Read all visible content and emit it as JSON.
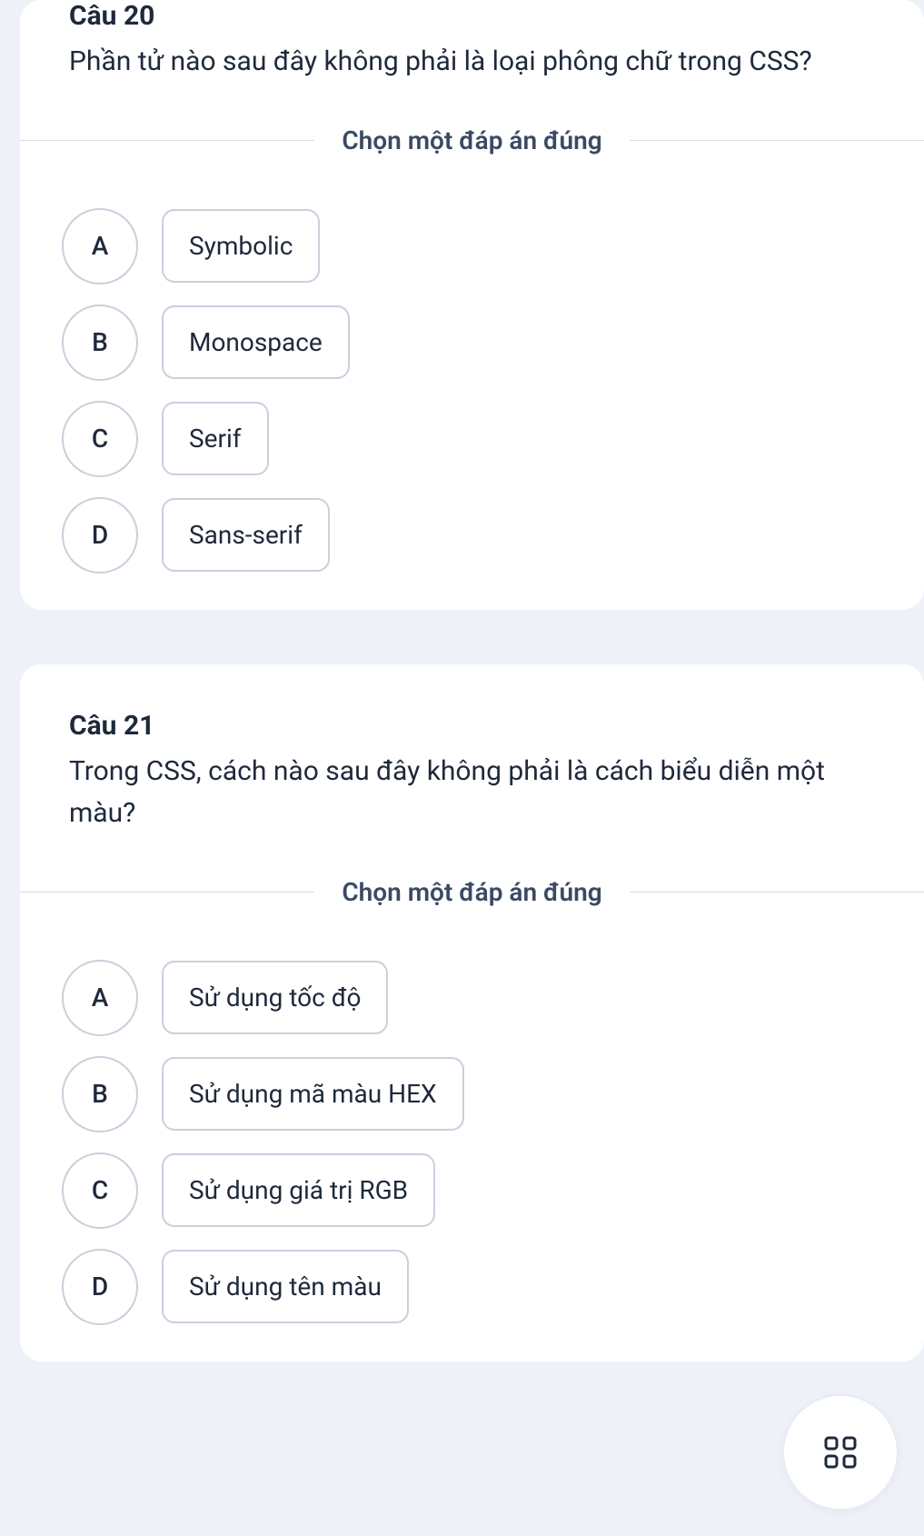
{
  "questions": [
    {
      "number": "Câu 20",
      "text": "Phần tử nào sau đây không phải là loại phông chữ trong CSS?",
      "instruction": "Chọn một đáp án đúng",
      "options": [
        {
          "letter": "A",
          "label": "Symbolic"
        },
        {
          "letter": "B",
          "label": "Monospace"
        },
        {
          "letter": "C",
          "label": "Serif"
        },
        {
          "letter": "D",
          "label": "Sans-serif"
        }
      ]
    },
    {
      "number": "Câu 21",
      "text": "Trong CSS, cách nào sau đây không phải là cách biểu diễn một màu?",
      "instruction": "Chọn một đáp án đúng",
      "options": [
        {
          "letter": "A",
          "label": "Sử dụng tốc độ"
        },
        {
          "letter": "B",
          "label": "Sử dụng mã màu HEX"
        },
        {
          "letter": "C",
          "label": "Sử dụng giá trị RGB"
        },
        {
          "letter": "D",
          "label": "Sử dụng tên màu"
        }
      ]
    }
  ],
  "fab_icon": "grid-icon"
}
